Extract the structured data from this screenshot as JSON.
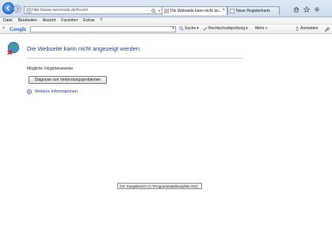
{
  "browser": {
    "address": {
      "url": "http://www.vwcorrado.de/forum/",
      "tools": [
        "search-icon",
        "dropdown-icon",
        "refresh-icon",
        "stop-icon"
      ]
    },
    "tabs": [
      {
        "label": "Die Webseite kann nicht an...",
        "active": true,
        "icon": "error-page-icon"
      },
      {
        "label": "Neue Registerkarte",
        "active": false,
        "icon": "new-tab-icon"
      }
    ],
    "window_icons": [
      "home-icon",
      "favorites-star-icon",
      "settings-gear-icon"
    ]
  },
  "menu": [
    "Datei",
    "Bearbeiten",
    "Ansicht",
    "Favoriten",
    "Extras",
    "?"
  ],
  "google_toolbar": {
    "logo": "Google",
    "search_label": "Suche",
    "spell_label": "Rechtschreibprüfung",
    "more_label": "Mehr »",
    "signin_label": "Anmelden"
  },
  "content": {
    "title": "Die Webseite kann nicht angezeigt werden.",
    "possible": "Mögliche Vorgehensweise:",
    "diagnose_button": "Diagnose von Verbindungsproblemen",
    "more_info": "Weitere Informationen"
  },
  "status_tooltip": "Ort: EasyBitsGO (C:\\ProgramData\\Easybits GO)",
  "colors": {
    "link_blue": "#1f3d8f",
    "accent_blue": "#1f5fc4",
    "chrome": "#dfe9f5"
  }
}
